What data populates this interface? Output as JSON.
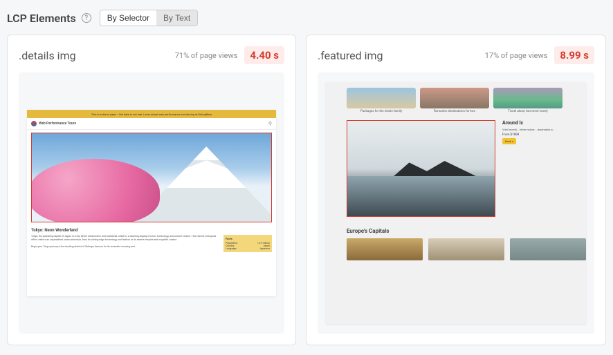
{
  "header": {
    "title": "LCP Elements",
    "toggle": {
      "bySelector": "By Selector",
      "byText": "By Text"
    }
  },
  "cards": [
    {
      "selector": ".details img",
      "pageViews": "71% of page views",
      "timing": "4.40 s",
      "mock": {
        "banner": "This is a demo page – the data is not real. Learn about web performance monitoring at DebugBear",
        "siteName": "Web Performance Tours",
        "articleTitle": "Tokyo: Neon Wonderland",
        "articleBody": "Tokyo, the sprawling capital of Japan, is a city where ultramodern and traditional collide in a dazzling display of neon, technology, and ancient culture. This vibrant metropolis offers visitors an unparalleled urban adventure, from its cutting-edge technology and fashion to its serene temples and exquisite cuisine.",
        "articleBody2": "Begin your Tokyo journey in the bustling district of Shibuya, famous for its scramble crossing and",
        "facts": {
          "heading": "Facts",
          "rows": [
            {
              "k": "Population:",
              "v": "13.9 million"
            },
            {
              "k": "Country:",
              "v": "Japan"
            },
            {
              "k": "Language:",
              "v": "Japanese"
            }
          ]
        }
      }
    },
    {
      "selector": ".featured img",
      "pageViews": "17% of page views",
      "timing": "8.99 s",
      "mock": {
        "thumbs": [
          "Packages for the whole family",
          "Romantic destinations for two",
          "Travel alone, but never lonely"
        ],
        "feature": {
          "title": "Around Ic",
          "desc": "Visit incredi... other nature... landmarks a...",
          "price": "From $1699",
          "cta": "Book n"
        },
        "section2": "Europe's Capitals"
      }
    }
  ]
}
